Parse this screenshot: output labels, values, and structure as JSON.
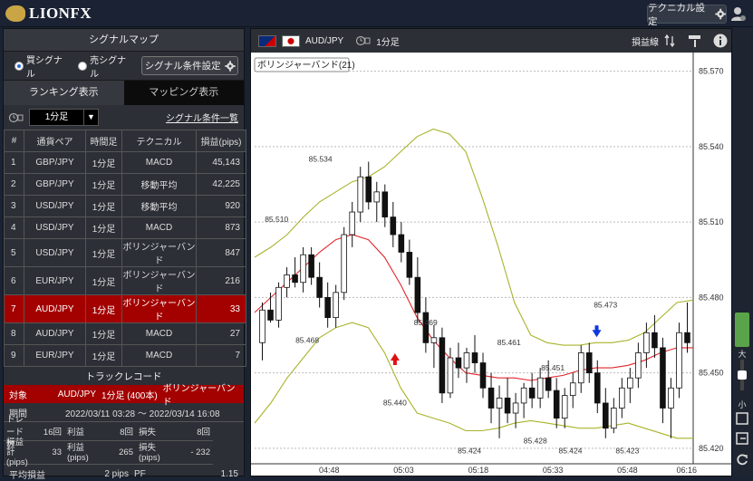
{
  "header": {
    "logo_text": "LIONFX",
    "technical_settings_label": "テクニカル設定"
  },
  "signal_panel": {
    "title": "シグナルマップ",
    "buy_signal_label": "買シグナル",
    "sell_signal_label": "売シグナル",
    "selected_signal": "buy",
    "condition_button_label": "シグナル条件設定",
    "tab_ranking_label": "ランキング表示",
    "tab_mapping_label": "マッピング表示",
    "timeframe_value": "1分足",
    "condition_list_link": "シグナル条件一覧",
    "table_headers": [
      "#",
      "通貨ペア",
      "時間足",
      "テクニカル",
      "損益(pips)"
    ],
    "rows": [
      {
        "idx": "1",
        "pair": "GBP/JPY",
        "tf": "1分足",
        "tech": "MACD",
        "pips": "45,143"
      },
      {
        "idx": "2",
        "pair": "GBP/JPY",
        "tf": "1分足",
        "tech": "移動平均",
        "pips": "42,225"
      },
      {
        "idx": "3",
        "pair": "USD/JPY",
        "tf": "1分足",
        "tech": "移動平均",
        "pips": "920"
      },
      {
        "idx": "4",
        "pair": "USD/JPY",
        "tf": "1分足",
        "tech": "MACD",
        "pips": "873"
      },
      {
        "idx": "5",
        "pair": "USD/JPY",
        "tf": "1分足",
        "tech": "ボリンジャーバンド",
        "pips": "847"
      },
      {
        "idx": "6",
        "pair": "EUR/JPY",
        "tf": "1分足",
        "tech": "ボリンジャーバンド",
        "pips": "216"
      },
      {
        "idx": "7",
        "pair": "AUD/JPY",
        "tf": "1分足",
        "tech": "ボリンジャーバンド",
        "pips": "33"
      },
      {
        "idx": "8",
        "pair": "AUD/JPY",
        "tf": "1分足",
        "tech": "MACD",
        "pips": "27"
      },
      {
        "idx": "9",
        "pair": "EUR/JPY",
        "tf": "1分足",
        "tech": "MACD",
        "pips": "7"
      }
    ],
    "selected_row": 6
  },
  "track_record": {
    "title": "トラックレコード",
    "target_label": "対象",
    "target_pair": "AUD/JPY",
    "target_tf": "1分足 (400本)",
    "target_tech": "ボリンジャーバンド",
    "period_label": "期間",
    "period_value": "2022/03/11 03:28 ～ 2022/03/14 16:08",
    "trades_label": "トレード数",
    "trades_value": "16回",
    "wins_label": "利益",
    "wins_value": "8回",
    "losses_label": "損失",
    "losses_value": "8回",
    "total_label": "損益計 (pips)",
    "total_value": "33",
    "profit_label": "利益 (pips)",
    "profit_value": "265",
    "loss_label": "損失 (pips)",
    "loss_value": "- 232",
    "avg_label": "平均損益",
    "avg_value": "2 pips",
    "pf_label": "PF",
    "pf_value": "1.15"
  },
  "chart_header": {
    "pair": "AUD/JPY",
    "timeframe": "1分足",
    "pnl_line_label": "損益線"
  },
  "chart_data": {
    "type": "candlestick",
    "title": "ボリンジャーバンド(21)",
    "y_ticks": [
      "85.570",
      "85.540",
      "85.510",
      "85.480",
      "85.450",
      "85.420"
    ],
    "x_ticks": [
      "04:48",
      "05:03",
      "05:18",
      "05:33",
      "05:48",
      "06:16"
    ],
    "ylim": [
      85.416,
      85.576
    ],
    "annotations": [
      {
        "text": "85.534",
        "x": 0.15,
        "y": 85.534
      },
      {
        "text": "85.510",
        "x": 0.05,
        "y": 85.51
      },
      {
        "text": "85.468",
        "x": 0.12,
        "y": 85.462
      },
      {
        "text": "85.469",
        "x": 0.39,
        "y": 85.469
      },
      {
        "text": "85.440",
        "x": 0.32,
        "y": 85.437
      },
      {
        "text": "85.461",
        "x": 0.58,
        "y": 85.461
      },
      {
        "text": "85.451",
        "x": 0.68,
        "y": 85.451
      },
      {
        "text": "85.473",
        "x": 0.8,
        "y": 85.476
      },
      {
        "text": "85.424",
        "x": 0.49,
        "y": 85.418
      },
      {
        "text": "85.428",
        "x": 0.64,
        "y": 85.422
      },
      {
        "text": "85.424",
        "x": 0.72,
        "y": 85.418
      },
      {
        "text": "85.423",
        "x": 0.85,
        "y": 85.418
      }
    ],
    "signals": [
      {
        "type": "buy",
        "x": 0.32,
        "y": 85.456
      },
      {
        "type": "sell",
        "x": 0.78,
        "y": 85.466
      }
    ],
    "candles": [
      [
        85.462,
        85.478,
        85.455,
        85.475
      ],
      [
        85.475,
        85.482,
        85.47,
        85.471
      ],
      [
        85.471,
        85.486,
        85.468,
        85.484
      ],
      [
        85.484,
        85.492,
        85.48,
        85.489
      ],
      [
        85.489,
        85.496,
        85.484,
        85.486
      ],
      [
        85.486,
        85.5,
        85.482,
        85.497
      ],
      [
        85.497,
        85.5,
        85.485,
        85.488
      ],
      [
        85.488,
        85.494,
        85.476,
        85.48
      ],
      [
        85.48,
        85.486,
        85.468,
        85.472
      ],
      [
        85.472,
        85.485,
        85.468,
        85.482
      ],
      [
        85.482,
        85.508,
        85.479,
        85.505
      ],
      [
        85.505,
        85.518,
        85.5,
        85.514
      ],
      [
        85.514,
        85.532,
        85.51,
        85.528
      ],
      [
        85.528,
        85.534,
        85.515,
        85.518
      ],
      [
        85.518,
        85.526,
        85.51,
        85.522
      ],
      [
        85.522,
        85.525,
        85.508,
        85.512
      ],
      [
        85.512,
        85.518,
        85.5,
        85.505
      ],
      [
        85.505,
        85.51,
        85.494,
        85.498
      ],
      [
        85.498,
        85.503,
        85.485,
        85.488
      ],
      [
        85.488,
        85.496,
        85.47,
        85.474
      ],
      [
        85.474,
        85.48,
        85.458,
        85.462
      ],
      [
        85.462,
        85.469,
        85.452,
        85.464
      ],
      [
        85.464,
        85.468,
        85.438,
        85.442
      ],
      [
        85.442,
        85.46,
        85.44,
        85.456
      ],
      [
        85.456,
        85.462,
        85.448,
        85.452
      ],
      [
        85.452,
        85.46,
        85.446,
        85.458
      ],
      [
        85.458,
        85.465,
        85.45,
        85.454
      ],
      [
        85.454,
        85.458,
        85.44,
        85.444
      ],
      [
        85.444,
        85.45,
        85.43,
        85.436
      ],
      [
        85.436,
        85.445,
        85.424,
        85.44
      ],
      [
        85.44,
        85.448,
        85.43,
        85.434
      ],
      [
        85.434,
        85.442,
        85.428,
        85.438
      ],
      [
        85.438,
        85.446,
        85.432,
        85.444
      ],
      [
        85.444,
        85.45,
        85.436,
        85.44
      ],
      [
        85.44,
        85.452,
        85.436,
        85.448
      ],
      [
        85.448,
        85.455,
        85.44,
        85.443
      ],
      [
        85.443,
        85.448,
        85.428,
        85.432
      ],
      [
        85.432,
        85.444,
        85.428,
        85.441
      ],
      [
        85.441,
        85.45,
        85.436,
        85.446
      ],
      [
        85.446,
        85.461,
        85.442,
        85.458
      ],
      [
        85.458,
        85.462,
        85.446,
        85.45
      ],
      [
        85.45,
        85.455,
        85.434,
        85.438
      ],
      [
        85.438,
        85.444,
        85.424,
        85.428
      ],
      [
        85.428,
        85.44,
        85.426,
        85.436
      ],
      [
        85.436,
        85.448,
        85.432,
        85.444
      ],
      [
        85.444,
        85.452,
        85.438,
        85.448
      ],
      [
        85.448,
        85.462,
        85.444,
        85.458
      ],
      [
        85.458,
        85.47,
        85.452,
        85.466
      ],
      [
        85.466,
        85.473,
        85.456,
        85.46
      ],
      [
        85.46,
        85.464,
        85.43,
        85.436
      ],
      [
        85.436,
        85.448,
        85.424,
        85.444
      ],
      [
        85.444,
        85.47,
        85.44,
        85.466
      ],
      [
        85.466,
        85.478,
        85.458,
        85.462
      ]
    ],
    "bands": {
      "upper": [
        85.496,
        85.5,
        85.505,
        85.512,
        85.518,
        85.522,
        85.526,
        85.528,
        85.532,
        85.538,
        85.544,
        85.547,
        85.545,
        85.538,
        85.52,
        85.5,
        85.478,
        85.465,
        85.462,
        85.461,
        85.461,
        85.462,
        85.462,
        85.463,
        85.466,
        85.472,
        85.478,
        85.479
      ],
      "middle": [
        85.474,
        85.48,
        85.486,
        85.492,
        85.498,
        85.503,
        85.505,
        85.503,
        85.496,
        85.485,
        85.472,
        85.463,
        85.456,
        85.45,
        85.449,
        85.448,
        85.448,
        85.447,
        85.448,
        85.449,
        85.451,
        85.452,
        85.452,
        85.453,
        85.455,
        85.458,
        85.46,
        85.46
      ],
      "lower": [
        85.43,
        85.438,
        85.448,
        85.456,
        85.464,
        85.468,
        85.47,
        85.468,
        85.458,
        85.444,
        85.434,
        85.432,
        85.43,
        85.427,
        85.427,
        85.428,
        85.43,
        85.431,
        85.43,
        85.429,
        85.428,
        85.428,
        85.429,
        85.43,
        85.428,
        85.426,
        85.424,
        85.424
      ]
    }
  }
}
